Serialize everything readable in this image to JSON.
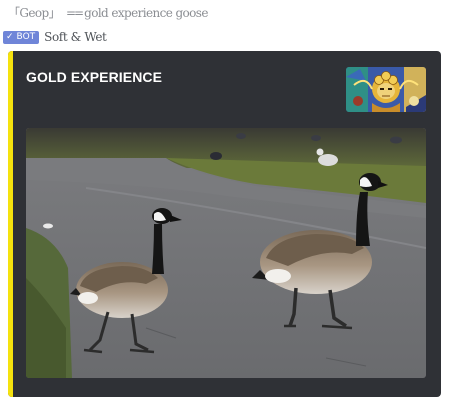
{
  "message": {
    "prefix": "「Geop」",
    "arrow": "==",
    "command": "gold experience goose"
  },
  "author": {
    "bot_label": "BOT",
    "name": "Soft & Wet"
  },
  "embed": {
    "title": "GOLD EXPERIENCE",
    "accent_color": "#f5e20e",
    "thumbnail_subject": "gold-experience-stand-icon",
    "image_subject": "two-canada-geese-on-path"
  }
}
